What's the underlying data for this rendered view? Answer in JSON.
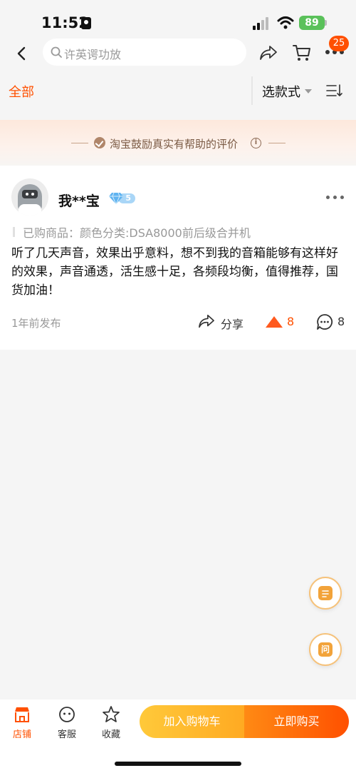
{
  "status_bar": {
    "time": "11:52",
    "battery": "89"
  },
  "nav": {
    "search_placeholder": "许英谔功放",
    "cart_badge": "25"
  },
  "filter": {
    "all_label": "全部",
    "style_label": "选款式"
  },
  "banner": {
    "text": "淘宝鼓励真实有帮助的评价",
    "info_symbol": "i"
  },
  "review": {
    "username": "我**宝",
    "level": "5",
    "sku": "已购商品：颜色分类:DSA8000前后级合并机",
    "content": "听了几天声音，效果出乎意料，想不到我的音箱能够有这样好的效果，声音通透，活生感十足，各频段均衡，值得推荐，国货加油！",
    "time": "1年前发布",
    "share_label": "分享",
    "like_count": "8",
    "comment_count": "8"
  },
  "float_buttons": {
    "ask_label": "问"
  },
  "bottom_bar": {
    "store_label": "店铺",
    "service_label": "客服",
    "favorite_label": "收藏",
    "add_cart_label": "加入购物车",
    "buy_now_label": "立即购买"
  },
  "colors": {
    "accent": "#ff5000",
    "cart_button": "#ffb020",
    "background": "#f5f5f5"
  },
  "icons": [
    "back-icon",
    "search-icon",
    "share-icon",
    "cart-icon",
    "more-icon",
    "sort-icon",
    "verify-icon",
    "info-icon",
    "diamond-icon",
    "like-icon",
    "comment-icon",
    "note-icon",
    "ask-icon",
    "store-icon",
    "service-icon",
    "star-icon"
  ]
}
